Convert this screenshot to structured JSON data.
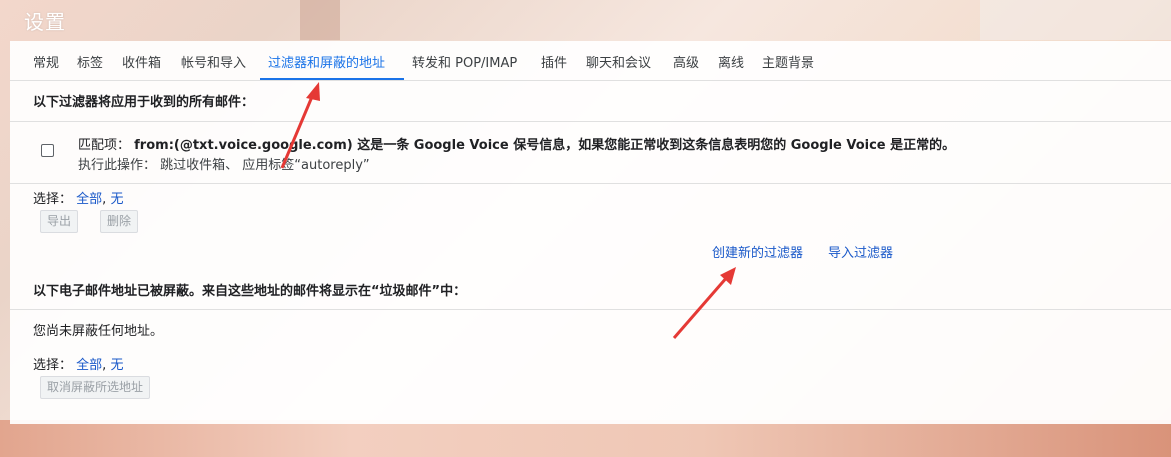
{
  "header": {
    "title": "设置"
  },
  "tabs": [
    {
      "label": "常规"
    },
    {
      "label": "标签"
    },
    {
      "label": "收件箱"
    },
    {
      "label": "帐号和导入"
    },
    {
      "label": "过滤器和屏蔽的地址"
    },
    {
      "label": "转发和 POP/IMAP"
    },
    {
      "label": "插件"
    },
    {
      "label": "聊天和会议"
    },
    {
      "label": "高级"
    },
    {
      "label": "离线"
    },
    {
      "label": "主题背景"
    }
  ],
  "active_tab": "过滤器和屏蔽的地址",
  "filters_section": {
    "title": "以下过滤器将应用于收到的所有邮件：",
    "filters": [
      {
        "match_label": "匹配项：",
        "criteria": "from:(@txt.voice.google.com) 这是一条 Google Voice 保号信息，如果您能正常收到这条信息表明您的 Google Voice 是正常的。",
        "action_label": "执行此操作：",
        "action": "跳过收件箱、 应用标签“autoreply”"
      }
    ],
    "select_label": "选择：",
    "select_all": "全部",
    "select_none": "无",
    "export_button": "导出",
    "delete_button": "删除",
    "create_filter_link": "创建新的过滤器",
    "import_filter_link": "导入过滤器"
  },
  "blocked_section": {
    "title": "以下电子邮件地址已被屏蔽。来自这些地址的邮件将显示在“垃圾邮件”中：",
    "empty_text": "您尚未屏蔽任何地址。",
    "select_label": "选择：",
    "select_all": "全部",
    "select_none": "无",
    "unblock_button": "取消屏蔽所选地址"
  },
  "colors": {
    "accent": "#1a73e8",
    "link": "#1a59c9",
    "annotation_arrow": "#e53935"
  }
}
